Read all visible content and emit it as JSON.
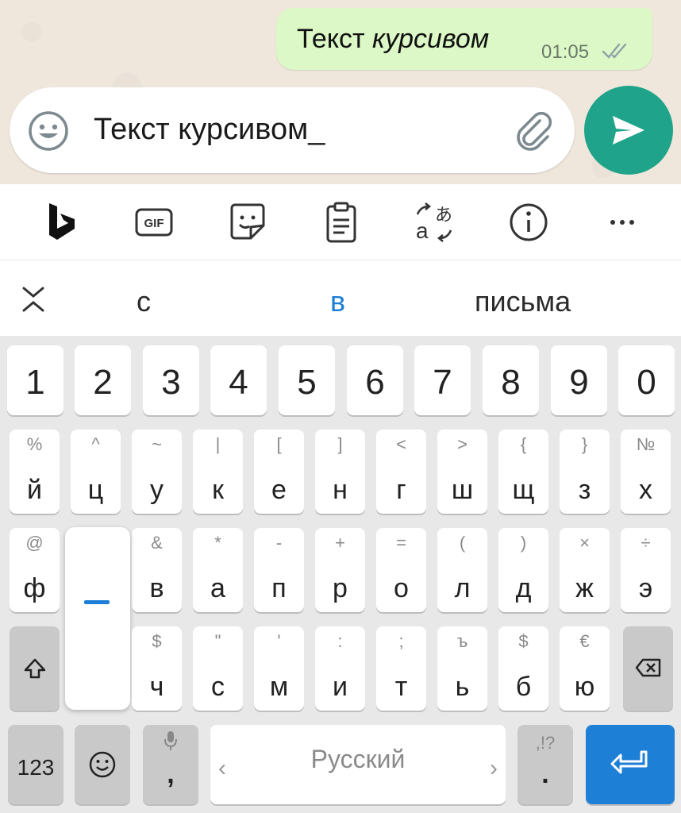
{
  "chat": {
    "message_plain": "Текст ",
    "message_italic": "курсивом",
    "time": "01:05"
  },
  "input": {
    "text": "Текст курсивом_"
  },
  "toolbar": {
    "items": [
      "bing-icon",
      "gif-icon",
      "sticker-icon",
      "clipboard-icon",
      "translate-icon",
      "info-icon",
      "more-icon"
    ]
  },
  "suggestions": {
    "left": "с",
    "middle": "в",
    "right": "письма"
  },
  "keyboard": {
    "numbers": [
      "1",
      "2",
      "3",
      "4",
      "5",
      "6",
      "7",
      "8",
      "9",
      "0"
    ],
    "row1": [
      {
        "main": "й",
        "alt": "%"
      },
      {
        "main": "ц",
        "alt": "^"
      },
      {
        "main": "у",
        "alt": "~"
      },
      {
        "main": "к",
        "alt": "|"
      },
      {
        "main": "е",
        "alt": "["
      },
      {
        "main": "н",
        "alt": "]"
      },
      {
        "main": "г",
        "alt": "<"
      },
      {
        "main": "ш",
        "alt": ">"
      },
      {
        "main": "щ",
        "alt": "{"
      },
      {
        "main": "з",
        "alt": "}"
      },
      {
        "main": "х",
        "alt": "№"
      }
    ],
    "row2": [
      {
        "main": "ф",
        "alt": "@"
      },
      {
        "main": "",
        "alt": ""
      },
      {
        "main": "в",
        "alt": "&"
      },
      {
        "main": "а",
        "alt": "*"
      },
      {
        "main": "п",
        "alt": "-"
      },
      {
        "main": "р",
        "alt": "+"
      },
      {
        "main": "о",
        "alt": "="
      },
      {
        "main": "л",
        "alt": "("
      },
      {
        "main": "д",
        "alt": ")"
      },
      {
        "main": "ж",
        "alt": "×"
      },
      {
        "main": "э",
        "alt": "÷"
      }
    ],
    "row3": [
      {
        "main": "ч",
        "alt": "$"
      },
      {
        "main": "с",
        "alt": "\""
      },
      {
        "main": "м",
        "alt": "'"
      },
      {
        "main": "и",
        "alt": ":"
      },
      {
        "main": "т",
        "alt": ";"
      },
      {
        "main": "ь",
        "alt": "ъ"
      },
      {
        "main": "б",
        "alt": "$"
      },
      {
        "main": "ю",
        "alt": "€"
      }
    ],
    "bottom": {
      "numbers_label": "123",
      "comma": ",",
      "space_label": "Русский",
      "arrow_left": "‹",
      "arrow_right": "›",
      "period": ".",
      "period_alt": ",!?"
    }
  },
  "colors": {
    "accent": "#1fa38a",
    "bubble": "#dcf8c6",
    "highlight": "#1e7fd6"
  }
}
